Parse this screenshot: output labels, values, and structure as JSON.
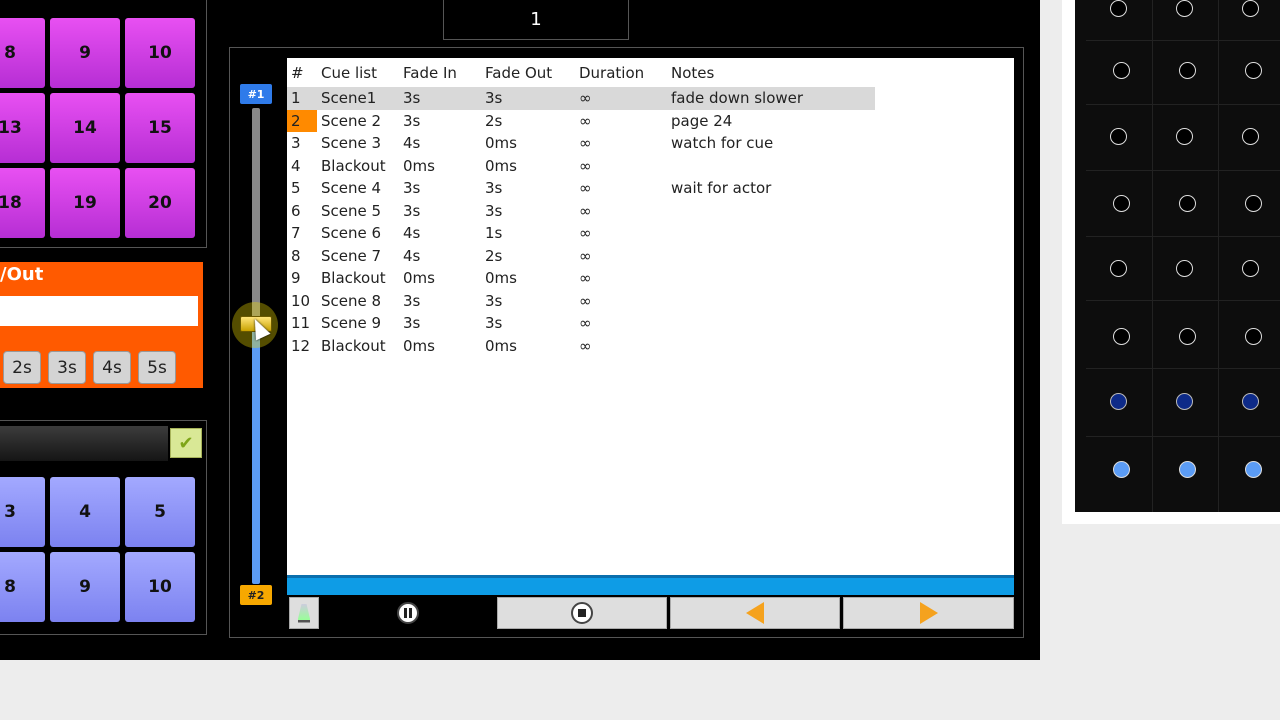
{
  "top_display": {
    "value": "1"
  },
  "top_pads": [
    "8",
    "9",
    "10",
    "13",
    "14",
    "15",
    "18",
    "19",
    "20"
  ],
  "fade_panel": {
    "title": "/Out",
    "times": [
      "2s",
      "3s",
      "4s",
      "5s"
    ]
  },
  "bottom_pads": [
    "3",
    "4",
    "5",
    "8",
    "9",
    "10"
  ],
  "slider": {
    "top_label": "#1",
    "bottom_label": "#2"
  },
  "cue_table": {
    "headers": [
      "#",
      "Cue list",
      "Fade In",
      "Fade Out",
      "Duration",
      "Notes"
    ],
    "rows": [
      [
        "1",
        "Scene1",
        "3s",
        "3s",
        "∞",
        "fade down slower"
      ],
      [
        "2",
        "Scene 2",
        "3s",
        "2s",
        "∞",
        "page 24"
      ],
      [
        "3",
        "Scene 3",
        "4s",
        "0ms",
        "∞",
        "watch for cue"
      ],
      [
        "4",
        "Blackout",
        "0ms",
        "0ms",
        "∞",
        ""
      ],
      [
        "5",
        "Scene 4",
        "3s",
        "3s",
        "∞",
        "wait for actor"
      ],
      [
        "6",
        "Scene 5",
        "3s",
        "3s",
        "∞",
        ""
      ],
      [
        "7",
        "Scene 6",
        "4s",
        "1s",
        "∞",
        ""
      ],
      [
        "8",
        "Scene 7",
        "4s",
        "2s",
        "∞",
        ""
      ],
      [
        "9",
        "Blackout",
        "0ms",
        "0ms",
        "∞",
        ""
      ],
      [
        "10",
        "Scene 8",
        "3s",
        "3s",
        "∞",
        ""
      ],
      [
        "11",
        "Scene 9",
        "3s",
        "3s",
        "∞",
        ""
      ],
      [
        "12",
        "Blackout",
        "0ms",
        "0ms",
        "∞",
        ""
      ]
    ],
    "selected_row": 1,
    "highlighted_row": 2
  },
  "controls": [
    "lamp-icon",
    "pause-icon",
    "stop-icon",
    "previous-arrow-icon",
    "next-arrow-icon"
  ],
  "fixtures": {
    "rows": [
      [
        "off",
        "off",
        "off"
      ],
      [
        "off",
        "off",
        "off"
      ],
      [
        "off",
        "off",
        "off"
      ],
      [
        "off",
        "off",
        "off"
      ],
      [
        "off",
        "off",
        "off"
      ],
      [
        "off",
        "off",
        "off"
      ],
      [
        "dark",
        "dark",
        "dark"
      ],
      [
        "light",
        "light",
        "light"
      ]
    ]
  },
  "colors": {
    "magenta": "#d43fe6",
    "orange": "#ff5a00",
    "blue_pad": "#8f95f8",
    "progress": "#0e9ce6"
  }
}
